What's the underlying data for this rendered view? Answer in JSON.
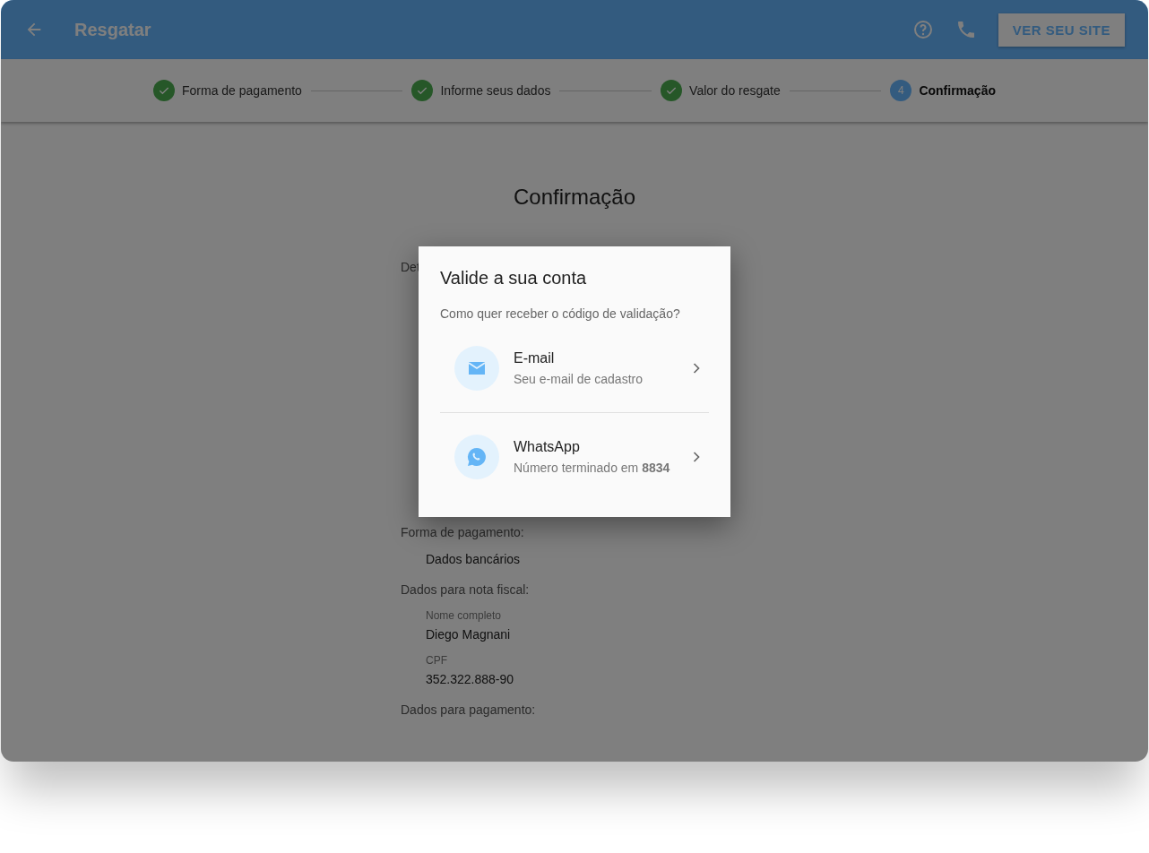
{
  "header": {
    "title": "Resgatar",
    "site_button": "VER SEU SITE"
  },
  "steps": [
    {
      "label": "Forma de pagamento",
      "completed": true,
      "selected": false
    },
    {
      "label": "Informe seus dados",
      "completed": true,
      "selected": false
    },
    {
      "label": "Valor do resgate",
      "completed": true,
      "selected": false
    },
    {
      "label": "Confirmação",
      "completed": false,
      "selected": true,
      "number": "4"
    }
  ],
  "page": {
    "title": "Confirmação",
    "partial_label": "Det",
    "sections": [
      {
        "label": "Forma de pagamento:",
        "fields": [
          {
            "value": "Dados bancários"
          }
        ]
      },
      {
        "label": "Dados para nota fiscal:",
        "fields": [
          {
            "name": "Nome completo",
            "value": "Diego Magnani"
          },
          {
            "name": "CPF",
            "value": "352.322.888-90"
          }
        ]
      },
      {
        "label": "Dados para pagamento:"
      }
    ]
  },
  "dialog": {
    "title": "Valide a sua conta",
    "subtitle": "Como quer receber o código de validação?",
    "options": [
      {
        "kind": "email",
        "title": "E-mail",
        "subtitle": "Seu e-mail de cadastro"
      },
      {
        "kind": "whatsapp",
        "title": "WhatsApp",
        "subtitle": "Número terminado em **8834**"
      }
    ]
  }
}
